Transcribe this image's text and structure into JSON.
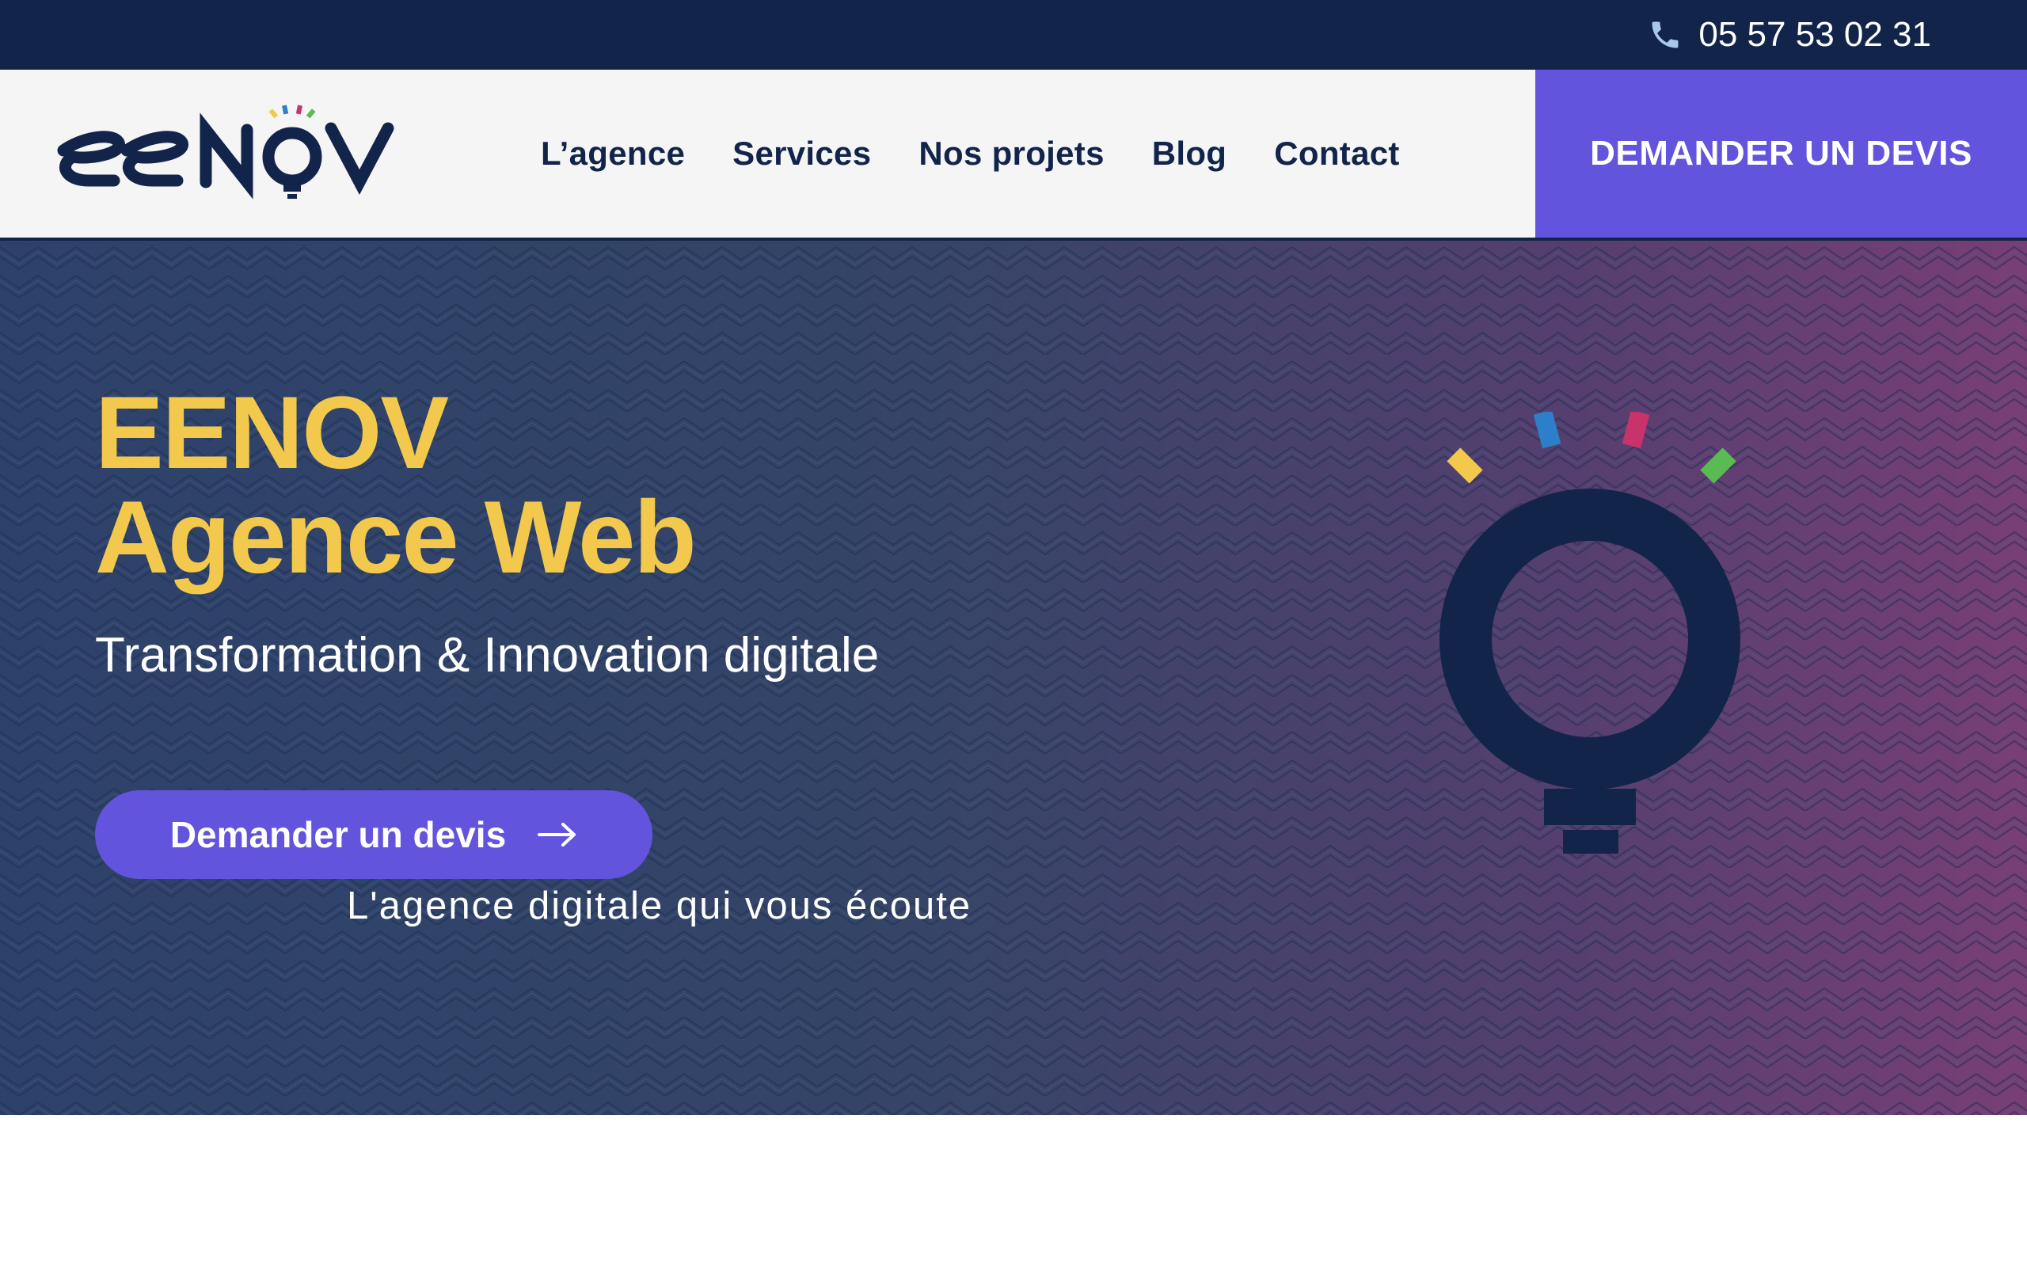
{
  "topbar": {
    "phone_icon": "phone-icon",
    "phone_number": "05 57 53 02 31"
  },
  "header": {
    "logo_text": "eenov",
    "nav": [
      {
        "label": "L’agence"
      },
      {
        "label": "Services"
      },
      {
        "label": "Nos projets"
      },
      {
        "label": "Blog"
      },
      {
        "label": "Contact"
      }
    ],
    "quote_button": "DEMANDER UN DEVIS"
  },
  "hero": {
    "title_line1": "EENOV",
    "title_line2": "Agence Web",
    "subtitle": "Transformation & Innovation digitale",
    "cta_label": "Demander un devis",
    "cta_icon": "arrow-right-icon",
    "tagline": "L'agence digitale qui vous écoute",
    "illustration": "lightbulb-icon"
  },
  "colors": {
    "navy": "#13244a",
    "accent": "#6254dc",
    "title_yellow": "#f2c94c",
    "spark_yellow": "#f2c94c",
    "spark_blue": "#2d7fc9",
    "spark_pink": "#c9336b",
    "spark_green": "#5bbb53"
  }
}
